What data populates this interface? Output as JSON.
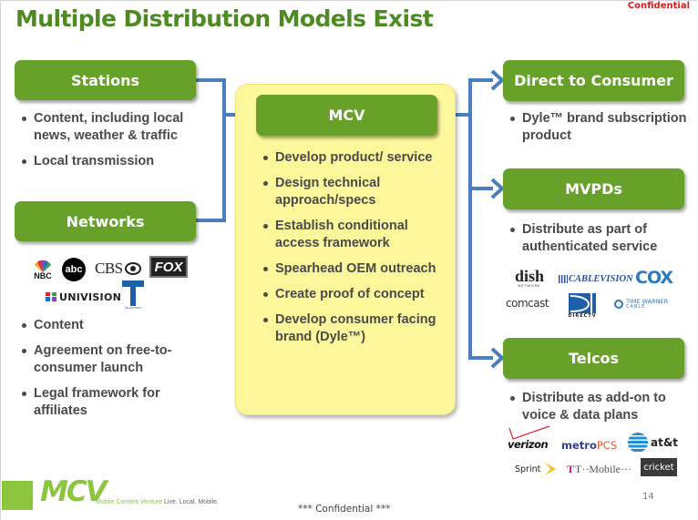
{
  "slide": {
    "title": "Multiple Distribution Models Exist",
    "confidential_top": "Confidential",
    "confidential_bottom": "*** Confidential ***",
    "page_number": "14"
  },
  "left": {
    "stations": {
      "label": "Stations",
      "bullets": [
        "Content, including local news, weather & traffic",
        "Local transmission"
      ]
    },
    "networks": {
      "label": "Networks",
      "logos": [
        "NBC",
        "abc",
        "CBS",
        "FOX",
        "UNIVISION",
        "TELEMUNDO"
      ],
      "bullets": [
        "Content",
        "Agreement on free-to-consumer launch",
        "Legal framework for affiliates"
      ]
    }
  },
  "center": {
    "label": "MCV",
    "bullets": [
      "Develop product/ service",
      "Design technical approach/specs",
      "Establish conditional access framework",
      "Spearhead OEM outreach",
      "Create proof of concept",
      "Develop consumer facing brand (Dyle™)"
    ]
  },
  "right": {
    "direct": {
      "label": "Direct to Consumer",
      "bullets": [
        "Dyle™ brand subscription product"
      ]
    },
    "mvpds": {
      "label": "MVPDs",
      "bullets": [
        "Distribute as part of authenticated service"
      ],
      "logos": [
        "dish",
        "NETWORK",
        "CABLEVISION",
        "COX",
        "comcast",
        "DIRECTV",
        "TIME WARNER",
        "CABLE"
      ]
    },
    "telcos": {
      "label": "Telcos",
      "bullets": [
        "Distribute as add-on to voice & data plans"
      ],
      "logos": [
        "verizon",
        "metro",
        "PCS",
        "at&t",
        "Sprint",
        "T··Mobile···",
        "cricket"
      ]
    }
  },
  "footer": {
    "logo": "MCV",
    "logo_sub": "Mobile Content Venture",
    "tagline": "Live. Local. Mobile."
  },
  "colors": {
    "title_green": "#4e8a22",
    "box_green": "#67a12a",
    "connector_blue": "#4a7ebf",
    "mcv_yellow": "#fdf79b",
    "confidential_red": "#cc1f1f",
    "footer_green": "#8cc63f"
  }
}
